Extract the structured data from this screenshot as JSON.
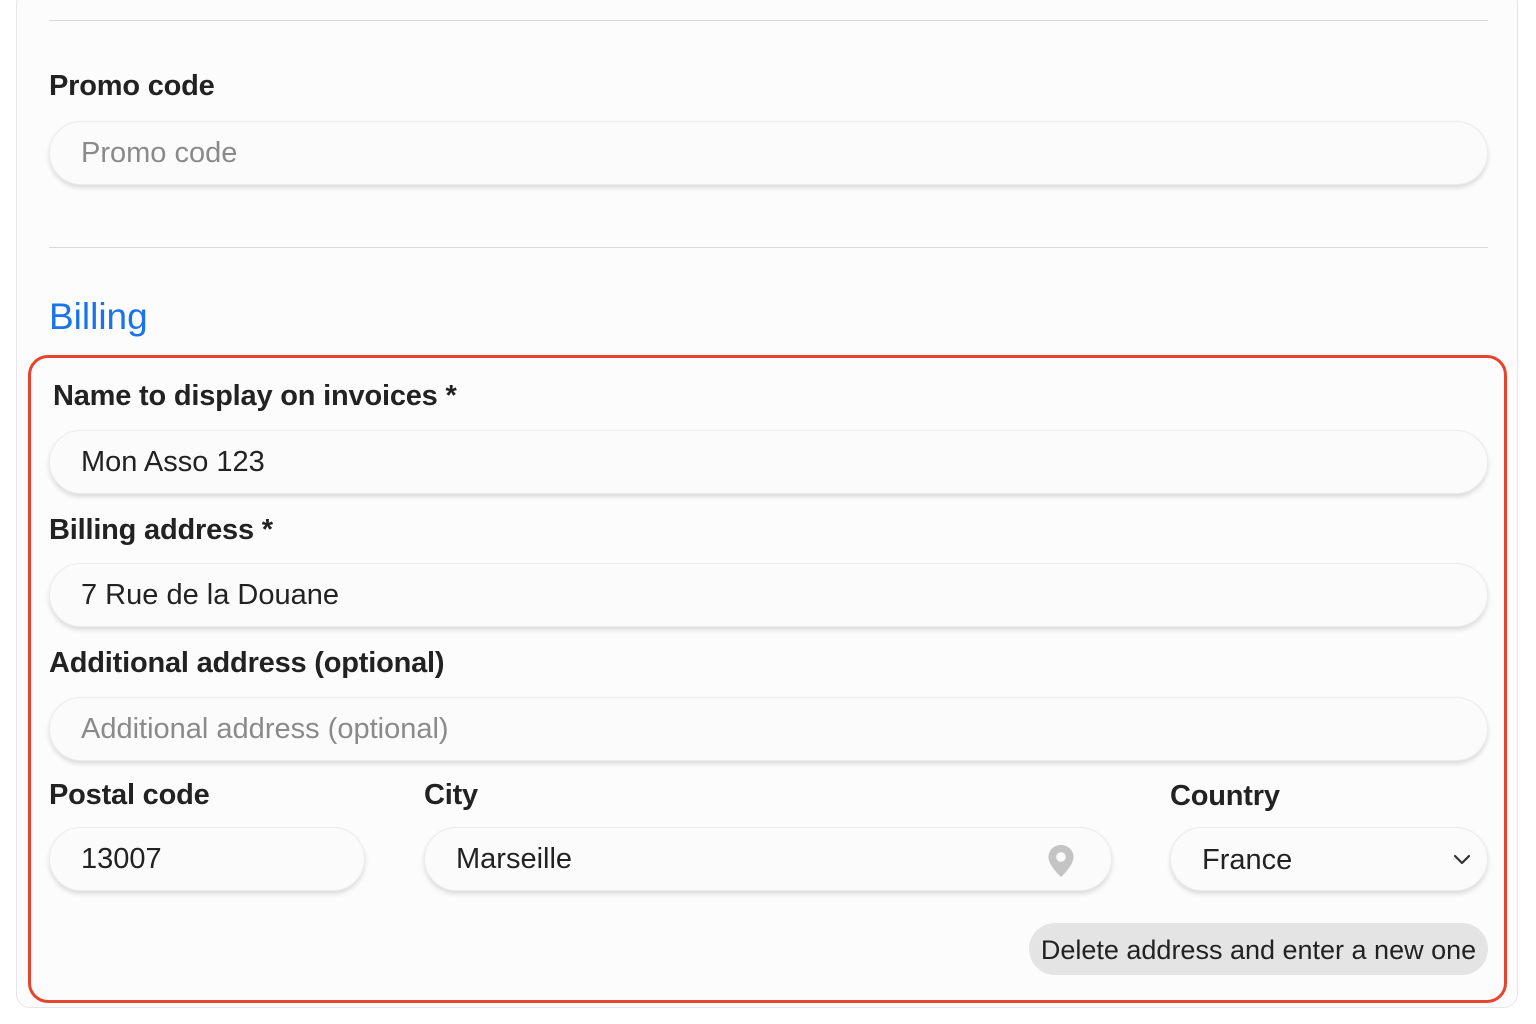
{
  "promo": {
    "label": "Promo code",
    "placeholder": "Promo code",
    "value": ""
  },
  "billing": {
    "section_title": "Billing",
    "name": {
      "label": "Name to display on invoices *",
      "value": "Mon Asso 123"
    },
    "address": {
      "label": "Billing address *",
      "value": "7 Rue de la Douane"
    },
    "additional": {
      "label": "Additional address (optional)",
      "placeholder": "Additional address (optional)",
      "value": ""
    },
    "postal": {
      "label": "Postal code",
      "value": "13007"
    },
    "city": {
      "label": "City",
      "value": "Marseille",
      "icon": "location-pin-icon"
    },
    "country": {
      "label": "Country",
      "value": "France",
      "icon": "chevron-down-icon"
    },
    "delete_button": "Delete address and enter a new one"
  },
  "colors": {
    "accent": "#1a73e8",
    "highlight_border": "#e8432c",
    "button_bg": "#e4e4e4"
  }
}
